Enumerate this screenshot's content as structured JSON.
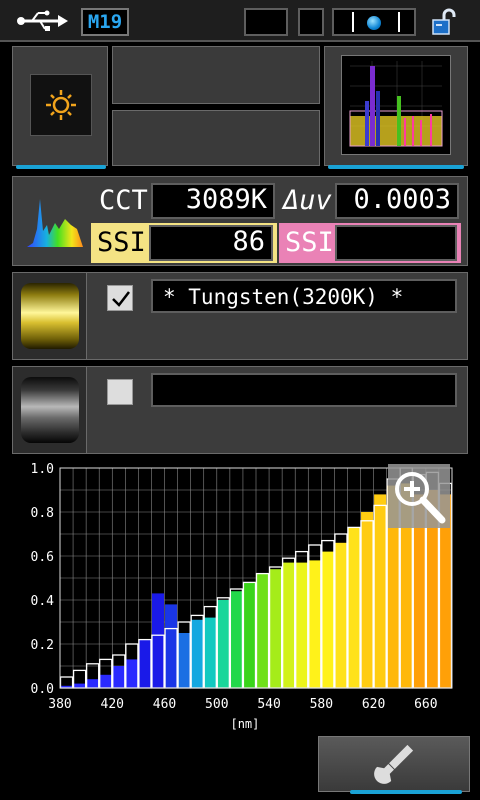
{
  "status_bar": {
    "usb_icon": "usb-icon",
    "memory_label": "M19",
    "slider_icon": "toggle-knob",
    "lock_icon": "lock-open-icon"
  },
  "top": {
    "mode_icon": "sun-icon",
    "spectrum_thumb_icon": "spectrum-thumbnail"
  },
  "readings": {
    "cct_label": "CCT",
    "cct_value": "3089K",
    "duv_label": "Δuv",
    "duv_value": "0.0003",
    "ssi1_label": "SSI",
    "ssi1_value": "86",
    "ssi2_label": "SSI",
    "ssi2_value": "",
    "ssi1_color": "#f4e384",
    "ssi2_color": "#ea82b6"
  },
  "references": [
    {
      "checked": true,
      "name": "* Tungsten(3200K) *",
      "slot_color": "#d9c030"
    },
    {
      "checked": false,
      "name": "",
      "slot_color": "#6a6a6a"
    }
  ],
  "chart_data": {
    "type": "bar",
    "xlabel": "[nm]",
    "ylabel": "",
    "xlim": [
      380,
      680
    ],
    "ylim": [
      0,
      1.0
    ],
    "x_ticks": [
      380,
      420,
      460,
      500,
      540,
      580,
      620,
      660
    ],
    "y_ticks": [
      0.0,
      0.2,
      0.4,
      0.6,
      0.8,
      1.0
    ],
    "grid": true,
    "bin_start": [
      380,
      390,
      400,
      410,
      420,
      430,
      440,
      450,
      460,
      470,
      480,
      490,
      500,
      510,
      520,
      530,
      540,
      550,
      560,
      570,
      580,
      590,
      600,
      610,
      620,
      630,
      640,
      650,
      660,
      670
    ],
    "series": [
      {
        "values": [
          0.01,
          0.02,
          0.04,
          0.06,
          0.1,
          0.13,
          0.22,
          0.43,
          0.38,
          0.25,
          0.31,
          0.32,
          0.4,
          0.44,
          0.48,
          0.52,
          0.54,
          0.57,
          0.57,
          0.58,
          0.62,
          0.66,
          0.73,
          0.8,
          0.88,
          0.92,
          0.93,
          0.88,
          0.9,
          0.88
        ]
      },
      {
        "values": [
          0.05,
          0.08,
          0.11,
          0.13,
          0.15,
          0.2,
          0.22,
          0.24,
          0.27,
          0.3,
          0.33,
          0.37,
          0.41,
          0.45,
          0.48,
          0.52,
          0.55,
          0.59,
          0.62,
          0.65,
          0.67,
          0.7,
          0.73,
          0.76,
          0.83,
          0.95,
          1.01,
          0.97,
          0.98,
          0.93
        ]
      }
    ]
  },
  "bottom": {
    "zoom_icon": "zoom-in-icon",
    "settings_icon": "wrench-icon"
  }
}
